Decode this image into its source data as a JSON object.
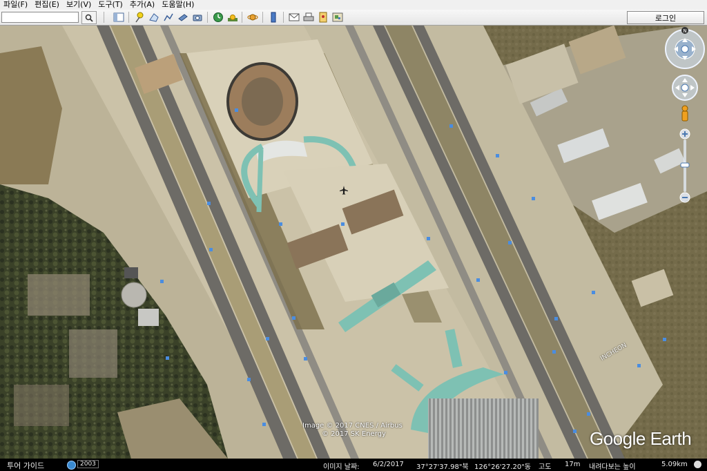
{
  "menu": {
    "items": [
      "파일(F)",
      "편집(E)",
      "보기(V)",
      "도구(T)",
      "추가(A)",
      "도움말(H)"
    ]
  },
  "toolbar": {
    "search_value": "",
    "login_label": "로그인"
  },
  "map": {
    "credit_line1": "Image © 2017 CNES / Airbus",
    "credit_line2": "© 2017 SK Energy",
    "runway_label": "INCHEON",
    "logo_text": "Google Earth",
    "compass_north": "N"
  },
  "statusbar": {
    "tour_guide_label": "투어 가이드",
    "year": "2003",
    "image_date_label": "이미지 날짜:",
    "image_date": "6/2/2017",
    "latitude": "37°27'37.98\"북",
    "longitude": "126°26'27.20\"동",
    "elev_label": "고도",
    "elevation": "17m",
    "eye_alt_label": "내려다보는 높이",
    "eye_alt": "5.09km"
  },
  "colors": {
    "terminal": "#7ec1b3",
    "apron": "#d7cfb7",
    "runway": "#7d7a72",
    "grass": "#6f6a48"
  }
}
